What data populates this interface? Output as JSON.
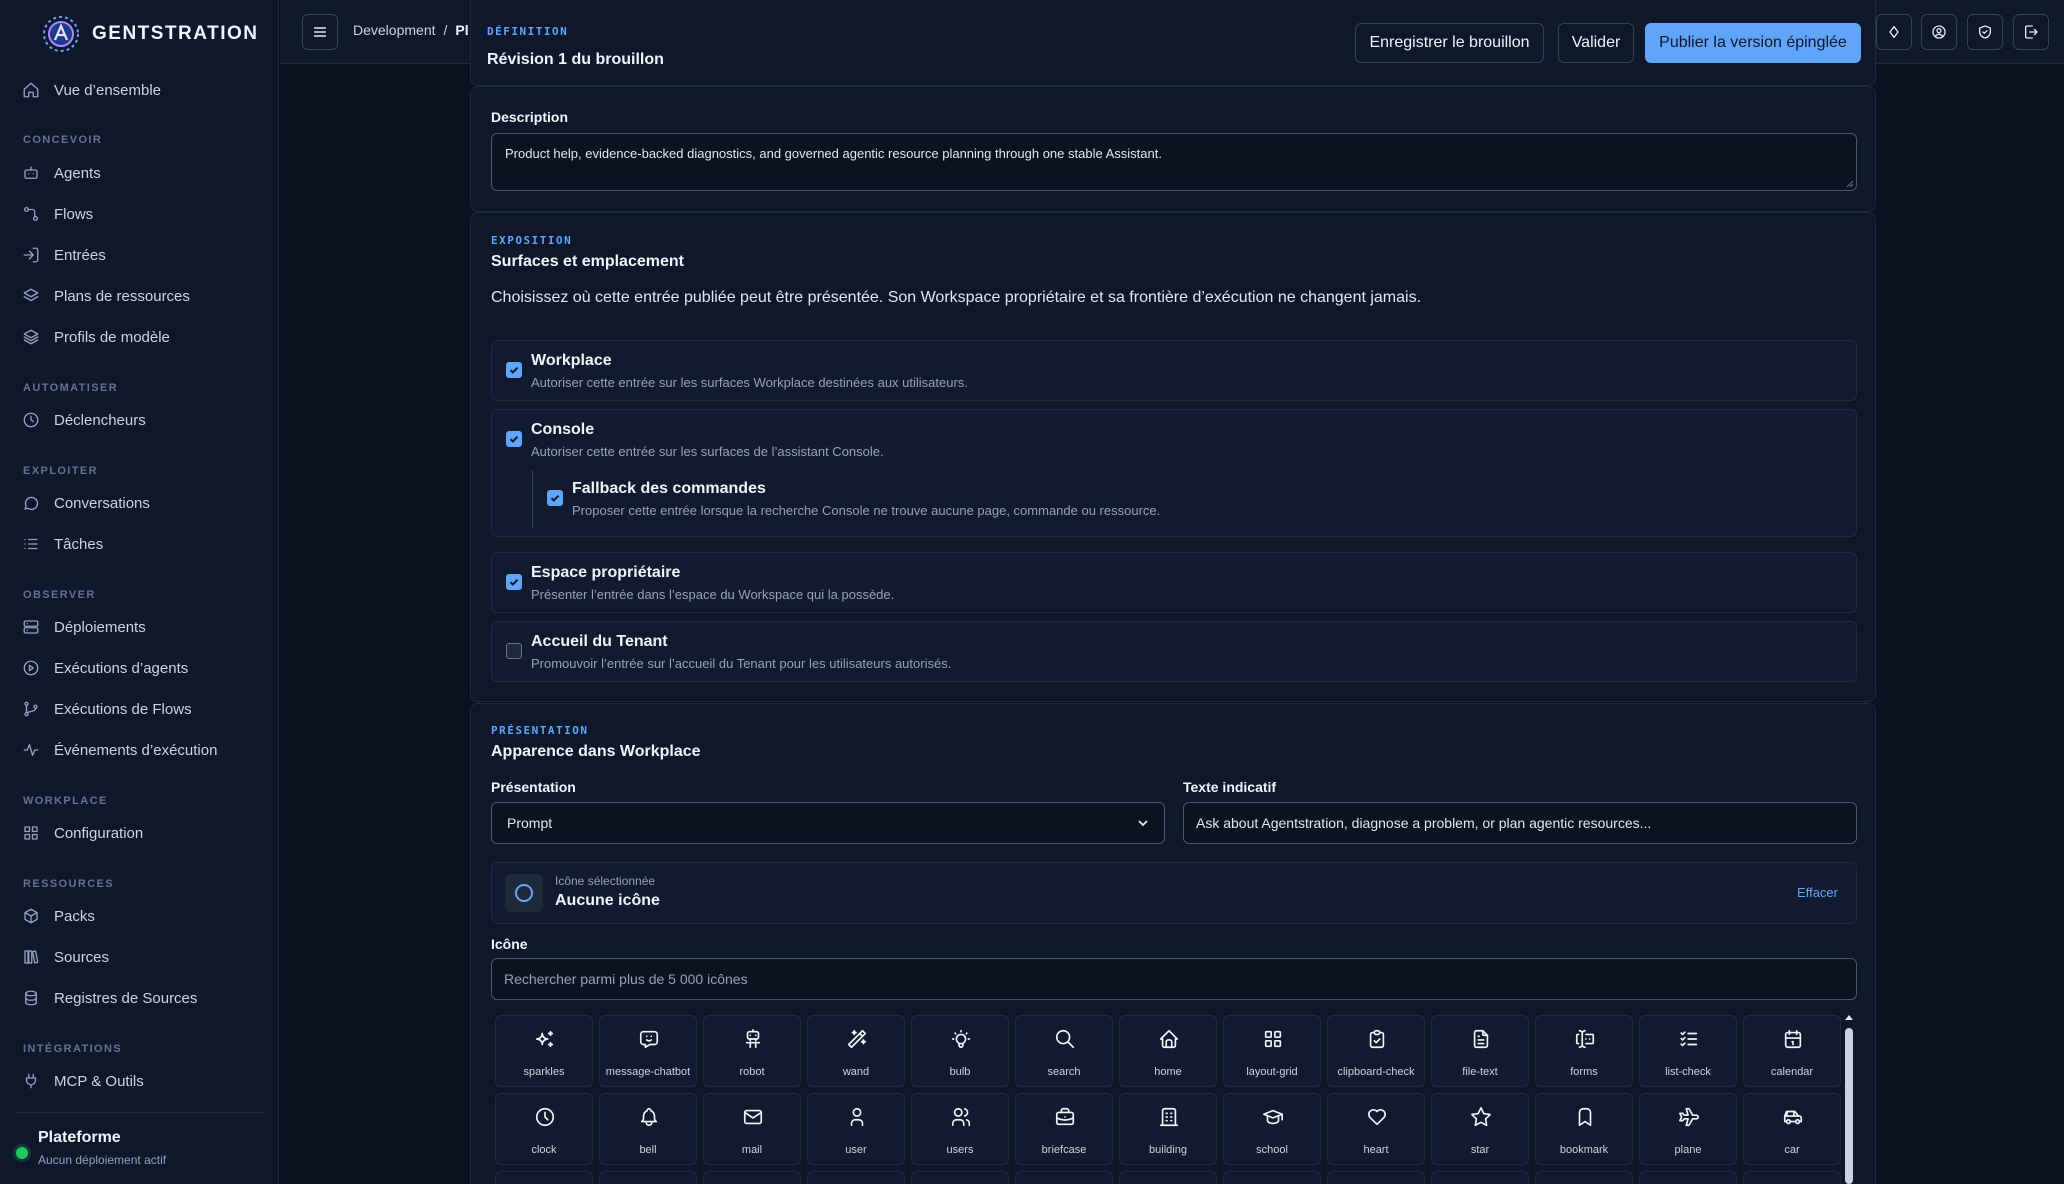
{
  "app": {
    "name": "GENTSTRATION"
  },
  "sidebar": {
    "overview": "Vue d’ensemble",
    "sections": {
      "concevoir": "CONCEVOIR",
      "automatiser": "AUTOMATISER",
      "exploiter": "EXPLOITER",
      "observer": "OBSERVER",
      "workplace": "WORKPLACE",
      "ressources": "RESSOURCES",
      "integrations": "INTÉGRATIONS"
    },
    "items": {
      "agents": "Agents",
      "flows": "Flows",
      "entrees": "Entrées",
      "plans": "Plans de ressources",
      "profils": "Profils de modèle",
      "declencheurs": "Déclencheurs",
      "conversations": "Conversations",
      "taches": "Tâches",
      "deploiements": "Déploiements",
      "executions_agents": "Exécutions d’agents",
      "executions_flows": "Exécutions de Flows",
      "evenements": "Événements d’exécution",
      "configuration": "Configuration",
      "packs": "Packs",
      "sources": "Sources",
      "registres": "Registres de Sources",
      "mcp": "MCP & Outils"
    },
    "platform": {
      "name": "Plateforme",
      "status": "Aucun déploiement actif"
    }
  },
  "topbar": {
    "breadcrumb": [
      "Development",
      "/",
      "Pl"
    ]
  },
  "definition": {
    "kicker": "DÉFINITION",
    "title": "Révision 1 du brouillon",
    "save_draft": "Enregistrer le brouillon",
    "validate": "Valider",
    "publish": "Publier la version épinglée"
  },
  "description": {
    "label": "Description",
    "value": "Product help, evidence-backed diagnostics, and governed agentic resource planning through one stable Assistant."
  },
  "exposition": {
    "kicker": "EXPOSITION",
    "title": "Surfaces et emplacement",
    "intro": "Choisissez où cette entrée publiée peut être présentée. Son Workspace propriétaire et sa frontière d’exécution ne changent jamais.",
    "options": {
      "workplace": {
        "title": "Workplace",
        "desc": "Autoriser cette entrée sur les surfaces Workplace destinées aux utilisateurs.",
        "checked": true
      },
      "console": {
        "title": "Console",
        "desc": "Autoriser cette entrée sur les surfaces de l’assistant Console.",
        "checked": true
      },
      "fallback": {
        "title": "Fallback des commandes",
        "desc": "Proposer cette entrée lorsque la recherche Console ne trouve aucune page, commande ou ressource.",
        "checked": true
      },
      "espace": {
        "title": "Espace propriétaire",
        "desc": "Présenter l’entrée dans l’espace du Workspace qui la possède.",
        "checked": true
      },
      "accueil": {
        "title": "Accueil du Tenant",
        "desc": "Promouvoir l’entrée sur l’accueil du Tenant pour les utilisateurs autorisés.",
        "checked": false
      }
    }
  },
  "presentation": {
    "kicker": "PRÉSENTATION",
    "title": "Apparence dans Workplace",
    "presentation_label": "Présentation",
    "presentation_value": "Prompt",
    "hint_label": "Texte indicatif",
    "hint_value": "Ask about Agentstration, diagnose a problem, or plan agentic resources...",
    "selected_icon_caption": "Icône sélectionnée",
    "selected_icon_value": "Aucune icône",
    "clear": "Effacer",
    "icon_label": "Icône",
    "icon_search_placeholder": "Rechercher parmi plus de 5 000 icônes",
    "icons": [
      "sparkles",
      "message-chatbot",
      "robot",
      "wand",
      "bulb",
      "search",
      "home",
      "layout-grid",
      "clipboard-check",
      "file-text",
      "forms",
      "list-check",
      "calendar",
      "clock",
      "bell",
      "mail",
      "user",
      "users",
      "briefcase",
      "building",
      "school",
      "heart",
      "star",
      "bookmark",
      "plane",
      "car"
    ]
  },
  "colors": {
    "accent": "#60a5fa",
    "background": "#0b1220",
    "surface": "#0f172a",
    "status_ok": "#22c55e"
  }
}
